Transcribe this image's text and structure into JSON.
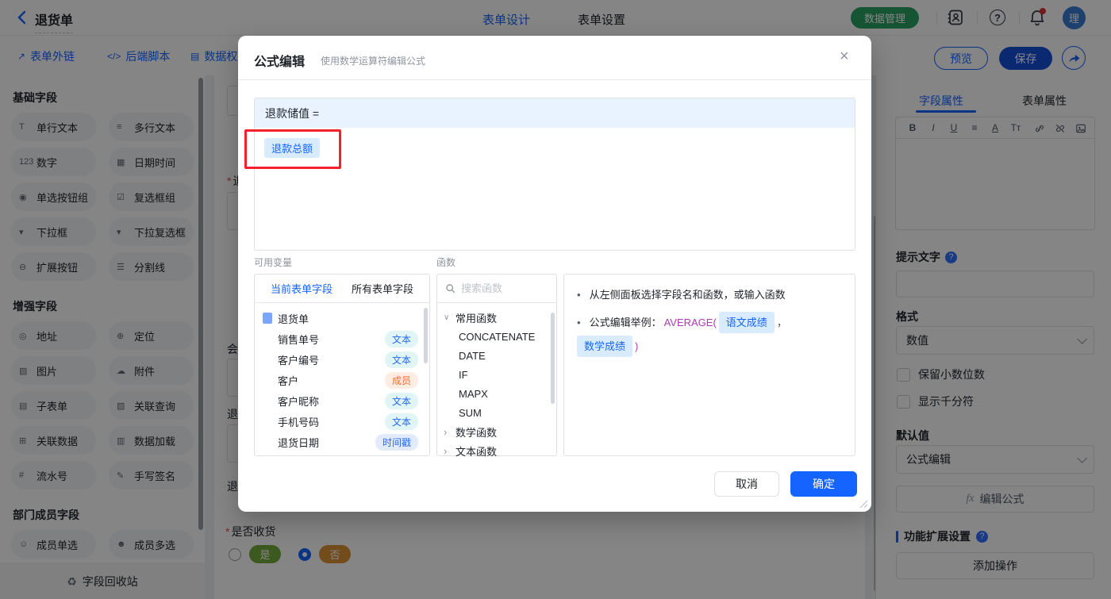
{
  "colors": {
    "accent_blue": "#1664ff",
    "brand_green": "#2aa464",
    "annotation_red": "#f5222d",
    "save_blue": "#1450d8",
    "option_green": "#74ab3e",
    "option_orange": "#dd9334"
  },
  "topbar": {
    "title": "退货单",
    "tabs": [
      {
        "label": "表单设计"
      },
      {
        "label": "表单设置"
      }
    ],
    "data_manage_button": "数据管理",
    "icons": [
      "back-icon",
      "contacts-icon",
      "help-icon",
      "bell-icon"
    ],
    "avatar_text": "理"
  },
  "action_bar": {
    "links": [
      {
        "icon": "↗",
        "label": "表单外链"
      },
      {
        "icon": "</>",
        "label": "后端脚本"
      },
      {
        "icon": "▤",
        "label": "数据权"
      }
    ],
    "preview_button": "预览",
    "save_button": "保存"
  },
  "left_sidebar": {
    "sections": [
      {
        "title": "基础字段",
        "items": [
          {
            "icon": "T",
            "label": "单行文本"
          },
          {
            "icon": "≡",
            "label": "多行文本"
          },
          {
            "icon": "123",
            "label": "数字"
          },
          {
            "icon": "▦",
            "label": "日期时间"
          },
          {
            "icon": "◉",
            "label": "单选按钮组"
          },
          {
            "icon": "☑",
            "label": "复选框组"
          },
          {
            "icon": "▾",
            "label": "下拉框"
          },
          {
            "icon": "▾",
            "label": "下拉复选框"
          },
          {
            "icon": "⊖",
            "label": "扩展按钮"
          },
          {
            "icon": "☰",
            "label": "分割线"
          }
        ]
      },
      {
        "title": "增强字段",
        "items": [
          {
            "icon": "◎",
            "label": "地址"
          },
          {
            "icon": "⊕",
            "label": "定位"
          },
          {
            "icon": "▨",
            "label": "图片"
          },
          {
            "icon": "☁",
            "label": "附件"
          },
          {
            "icon": "▤",
            "label": "子表单"
          },
          {
            "icon": "▧",
            "label": "关联查询"
          },
          {
            "icon": "⊞",
            "label": "关联数据"
          },
          {
            "icon": "▥",
            "label": "数据加载"
          },
          {
            "icon": "#",
            "label": "流水号"
          },
          {
            "icon": "✎",
            "label": "手写签名"
          }
        ]
      },
      {
        "title": "部门成员字段",
        "items": [
          {
            "icon": "☺",
            "label": "成员单选"
          },
          {
            "icon": "☻",
            "label": "成员多选"
          }
        ]
      }
    ],
    "recycle_bin": "字段回收站"
  },
  "canvas": {
    "clipped_labels": [
      {
        "text": "退"
      },
      {
        "text": "会"
      },
      {
        "text": "退"
      },
      {
        "text": "退"
      }
    ],
    "receive_field": {
      "label": "是否收货",
      "options": [
        {
          "label": "是",
          "state": "",
          "color_class": "green"
        },
        {
          "label": "否",
          "state": "checked",
          "color_class": "orange"
        }
      ]
    }
  },
  "modal": {
    "title": "公式编辑",
    "subtitle": "使用数学运算符编辑公式",
    "formula": {
      "target": "退款储值 =",
      "chip": "退款总额"
    },
    "variables": {
      "label": "可用变量",
      "tabs": [
        {
          "label": "当前表单字段",
          "state": "active"
        },
        {
          "label": "所有表单字段",
          "state": ""
        }
      ],
      "form_name": "退货单",
      "fields": [
        {
          "name": "销售单号",
          "type": "文本",
          "type_key": "text"
        },
        {
          "name": "客户编号",
          "type": "文本",
          "type_key": "text"
        },
        {
          "name": "客户",
          "type": "成员",
          "type_key": "member"
        },
        {
          "name": "客户昵称",
          "type": "文本",
          "type_key": "text"
        },
        {
          "name": "手机号码",
          "type": "文本",
          "type_key": "text"
        },
        {
          "name": "退货日期",
          "type": "时间戳",
          "type_key": "timestamp"
        }
      ]
    },
    "functions": {
      "label": "函数",
      "search_placeholder": "搜索函数",
      "rows": [
        {
          "label": "常用函数",
          "kind": "group",
          "state": "expanded"
        },
        {
          "label": "CONCATENATE",
          "kind": "item",
          "state": ""
        },
        {
          "label": "DATE",
          "kind": "item",
          "state": ""
        },
        {
          "label": "IF",
          "kind": "item",
          "state": ""
        },
        {
          "label": "MAPX",
          "kind": "item",
          "state": ""
        },
        {
          "label": "SUM",
          "kind": "item",
          "state": ""
        },
        {
          "label": "数学函数",
          "kind": "group",
          "state": ""
        },
        {
          "label": "文本函数",
          "kind": "group",
          "state": ""
        }
      ]
    },
    "hints": {
      "line1": "从左侧面板选择字段名和函数，或输入函数",
      "line2_prefix": "公式编辑举例：",
      "func_open": "AVERAGE(",
      "chip1": "语文成绩",
      "comma": "，",
      "chip2": "数学成绩",
      "func_close": ")"
    },
    "cancel_button": "取消",
    "confirm_button": "确定"
  },
  "right_sidebar": {
    "tabs": [
      {
        "label": "字段属性"
      },
      {
        "label": "表单属性"
      }
    ],
    "richtext_icons": [
      {
        "glyph": "B",
        "cls": "b"
      },
      {
        "glyph": "I",
        "cls": "i"
      },
      {
        "glyph": "U",
        "cls": "u"
      },
      {
        "glyph": "≡",
        "cls": "al"
      },
      {
        "glyph": "A",
        "cls": "a"
      },
      {
        "glyph": "Tт",
        "cls": "t"
      }
    ],
    "richtext_svg_icons": [
      "link-icon",
      "unlink-icon",
      "image-icon"
    ],
    "hint_label": "提示文字",
    "format_label": "格式",
    "format_value": "数值",
    "checkbox1": "保留小数位数",
    "checkbox2": "显示千分符",
    "default_label": "默认值",
    "default_value": "公式编辑",
    "fx": "fx",
    "edit_formula_button": "编辑公式",
    "extension_label": "功能扩展设置",
    "add_action_button": "添加操作"
  }
}
